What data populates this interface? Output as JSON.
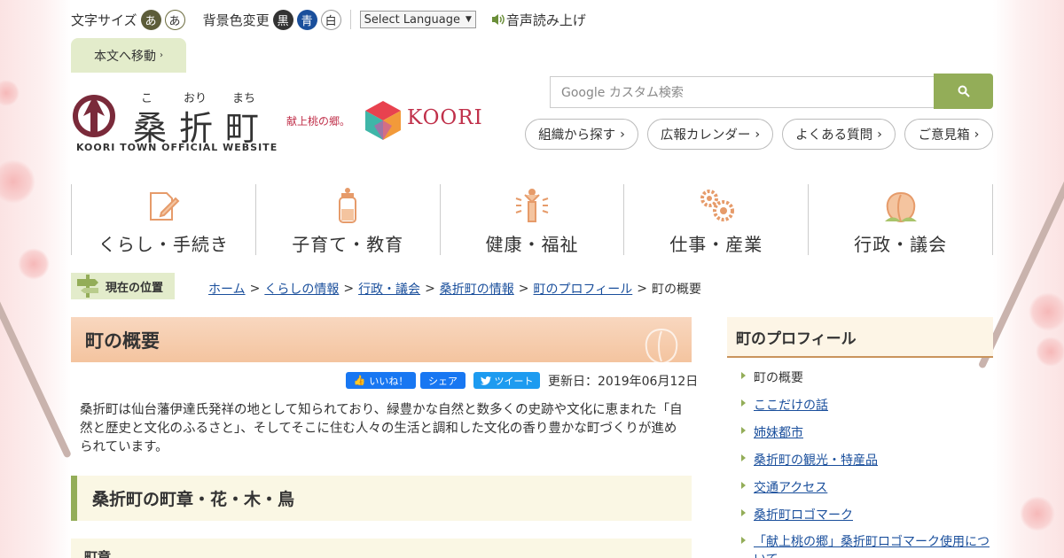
{
  "utility": {
    "font_size_label": "文字サイズ",
    "font_size_options": [
      "あ",
      "あ"
    ],
    "bg_color_label": "背景色変更",
    "bg_options": [
      "黒",
      "青",
      "白"
    ],
    "language_select": "Select Language",
    "voice_label": "音声読み上げ"
  },
  "skip_link": "本文へ移動",
  "logo": {
    "kana": [
      "こ",
      "おり",
      "まち"
    ],
    "main": "桑折町",
    "sub": "KOORI TOWN OFFICIAL WEBSITE",
    "tagline": "献上桃の郷。",
    "brand": "KOORI"
  },
  "search": {
    "placeholder": "Google カスタム検索"
  },
  "quick_links": [
    "組織から探す",
    "広報カレンダー",
    "よくある質問",
    "ご意見箱"
  ],
  "global_nav": [
    {
      "label": "くらし・手続き",
      "icon": "document-pencil-icon"
    },
    {
      "label": "子育て・教育",
      "icon": "baby-bottle-icon"
    },
    {
      "label": "健康・福祉",
      "icon": "person-radiant-icon"
    },
    {
      "label": "仕事・産業",
      "icon": "gears-icon"
    },
    {
      "label": "行政・議会",
      "icon": "peach-icon"
    }
  ],
  "breadcrumb": {
    "label": "現在の位置",
    "items": [
      "ホーム",
      "くらしの情報",
      "行政・議会",
      "桑折町の情報",
      "町のプロフィール"
    ],
    "current": "町の概要",
    "sep": ">"
  },
  "page": {
    "title": "町の概要",
    "like": "いいね！",
    "share": "シェア",
    "tweet": "ツイート",
    "updated": "更新日：2019年06月12日",
    "intro": "桑折町は仙台藩伊達氏発祥の地として知られており、緑豊かな自然と数多くの史跡や文化に恵まれた「自然と歴史と文化のふるさと」、そしてそこに住む人々の生活と調和した文化の香り豊かな町づくりが進められています。",
    "h2": "桑折町の町章・花・木・鳥",
    "h3": "町章"
  },
  "sidebar": {
    "title": "町のプロフィール",
    "items": [
      {
        "label": "町の概要",
        "link": false
      },
      {
        "label": "ここだけの話",
        "link": true
      },
      {
        "label": "姉妹都市",
        "link": true
      },
      {
        "label": "桑折町の観光・特産品",
        "link": true
      },
      {
        "label": "交通アクセス",
        "link": true
      },
      {
        "label": "桑折町ロゴマーク",
        "link": true
      },
      {
        "label": "「献上桃の郷」桑折町ロゴマーク使用について",
        "link": true
      }
    ]
  },
  "colors": {
    "accent_green": "#93ad58",
    "link_blue": "#1a4f9c",
    "brand_red": "#c0304a"
  }
}
